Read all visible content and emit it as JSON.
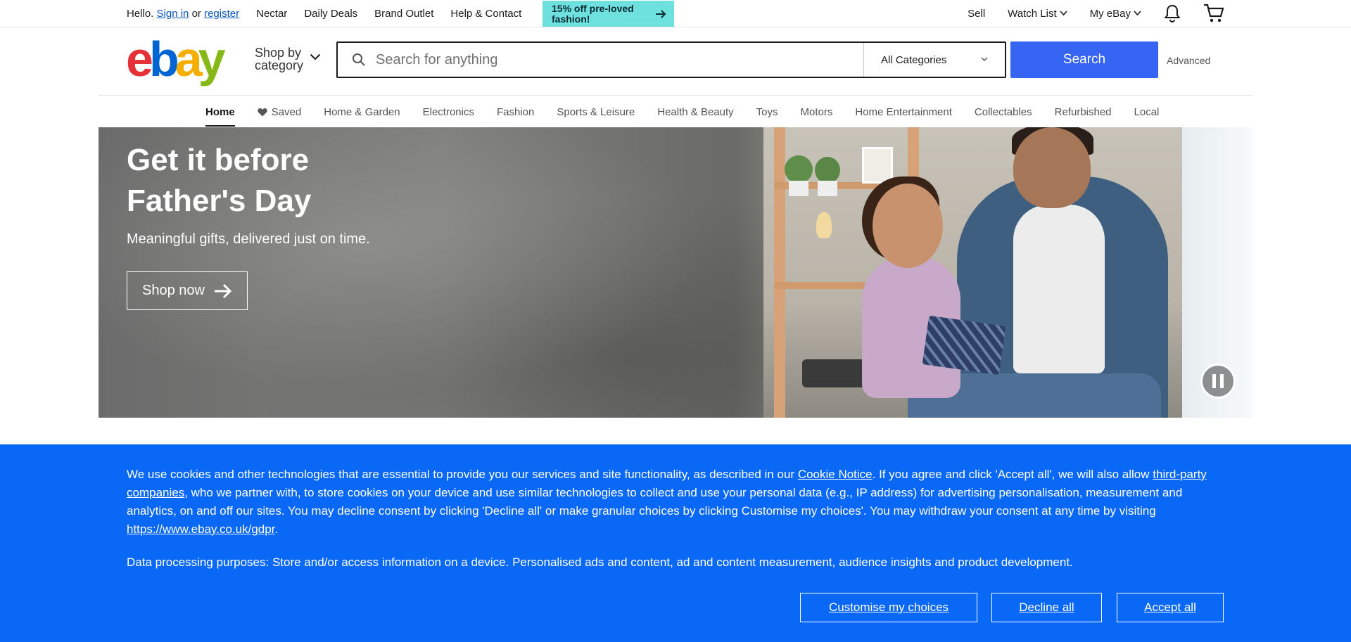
{
  "topbar": {
    "hello": "Hello.",
    "sign_in": "Sign in",
    "or": "or",
    "register": "register",
    "links": [
      "Nectar",
      "Daily Deals",
      "Brand Outlet",
      "Help & Contact"
    ],
    "promo_text": "15% off pre-loved fashion!",
    "sell": "Sell",
    "watch_list": "Watch List",
    "my_ebay": "My eBay"
  },
  "header": {
    "logo_letters": [
      "e",
      "b",
      "a",
      "y"
    ],
    "shop_by_line1": "Shop by",
    "shop_by_line2": "category",
    "search_placeholder": "Search for anything",
    "category_selected": "All Categories",
    "search_button": "Search",
    "advanced": "Advanced"
  },
  "nav": {
    "items": [
      "Home",
      "Saved",
      "Home & Garden",
      "Electronics",
      "Fashion",
      "Sports & Leisure",
      "Health & Beauty",
      "Toys",
      "Motors",
      "Home Entertainment",
      "Collectables",
      "Refurbished",
      "Local"
    ],
    "active": "Home"
  },
  "hero": {
    "title_line1": "Get it before",
    "title_line2": "Father's Day",
    "subtitle": "Meaningful gifts, delivered just on time.",
    "cta": "Shop now"
  },
  "cookie": {
    "p1_a": "We use cookies and other technologies that are essential to provide you our services and site functionality, as described in our ",
    "cookie_notice": "Cookie Notice",
    "p1_b": ". If you agree and click 'Accept all', we will also allow ",
    "third_party": "third-party companies",
    "p1_c": ", who we partner with, to store cookies on your device and use similar technologies to collect and use your personal data (e.g., IP address) for advertising personalisation, measurement and analytics, on and off our sites. You may decline consent by clicking 'Decline all' or make granular choices by clicking Customise my choices'. You may withdraw your consent at any time by visiting ",
    "gdpr_link": "https://www.ebay.co.uk/gdpr",
    "p1_d": ".",
    "p2": "Data processing purposes: Store and/or access information on a device. Personalised ads and content, ad and content measurement, audience insights and product development.",
    "customise": "Customise my choices",
    "decline": "Decline all",
    "accept": "Accept all"
  },
  "colors": {
    "search_blue": "#3665f3",
    "cookie_blue": "#0968f6",
    "promo_teal": "#6ee1df",
    "logo_red": "#e53238",
    "logo_blue": "#0064d2",
    "logo_yellow": "#f5af02",
    "logo_green": "#86b817"
  },
  "icons": [
    "search-icon",
    "chevron-down-icon",
    "bell-icon",
    "cart-icon",
    "heart-icon",
    "arrow-right-icon",
    "pause-icon"
  ]
}
